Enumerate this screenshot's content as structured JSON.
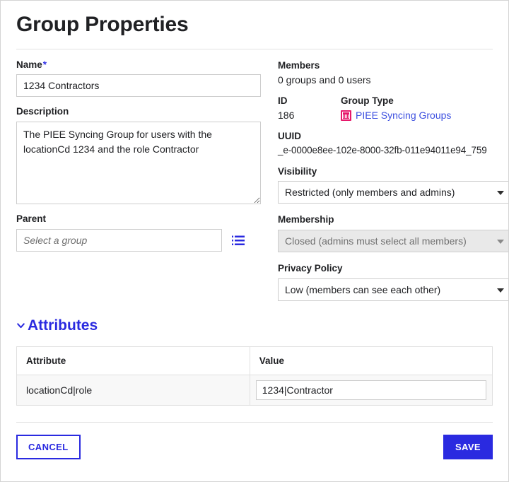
{
  "page": {
    "title": "Group Properties"
  },
  "form": {
    "name": {
      "label": "Name",
      "required_marker": "*",
      "value": "1234 Contractors"
    },
    "description": {
      "label": "Description",
      "value": "The PIEE Syncing Group for users with the locationCd 1234 and the role Contractor"
    },
    "parent": {
      "label": "Parent",
      "value": "",
      "placeholder": "Select a group",
      "picker_icon": "list-icon"
    }
  },
  "details": {
    "members": {
      "label": "Members",
      "value": "0 groups and 0 users"
    },
    "id": {
      "label": "ID",
      "value": "186"
    },
    "group_type": {
      "label": "Group Type",
      "value": "PIEE Syncing Groups",
      "icon": "group-type-icon",
      "icon_color": "#e6186b",
      "link_color": "#3d50e0"
    },
    "uuid": {
      "label": "UUID",
      "value": "_e-0000e8ee-102e-8000-32fb-011e94011e94_759"
    },
    "visibility": {
      "label": "Visibility",
      "value": "Restricted (only members and admins)",
      "disabled": false
    },
    "membership": {
      "label": "Membership",
      "value": "Closed (admins must select all members)",
      "disabled": true
    },
    "privacy_policy": {
      "label": "Privacy Policy",
      "value": "Low (members can see each other)",
      "disabled": false
    }
  },
  "attributes": {
    "section_title": "Attributes",
    "expanded": true,
    "columns": [
      "Attribute",
      "Value"
    ],
    "rows": [
      {
        "attribute": "locationCd|role",
        "value": "1234|Contractor"
      }
    ]
  },
  "footer": {
    "cancel_label": "CANCEL",
    "save_label": "SAVE",
    "accent_color": "#2a2ae0"
  }
}
